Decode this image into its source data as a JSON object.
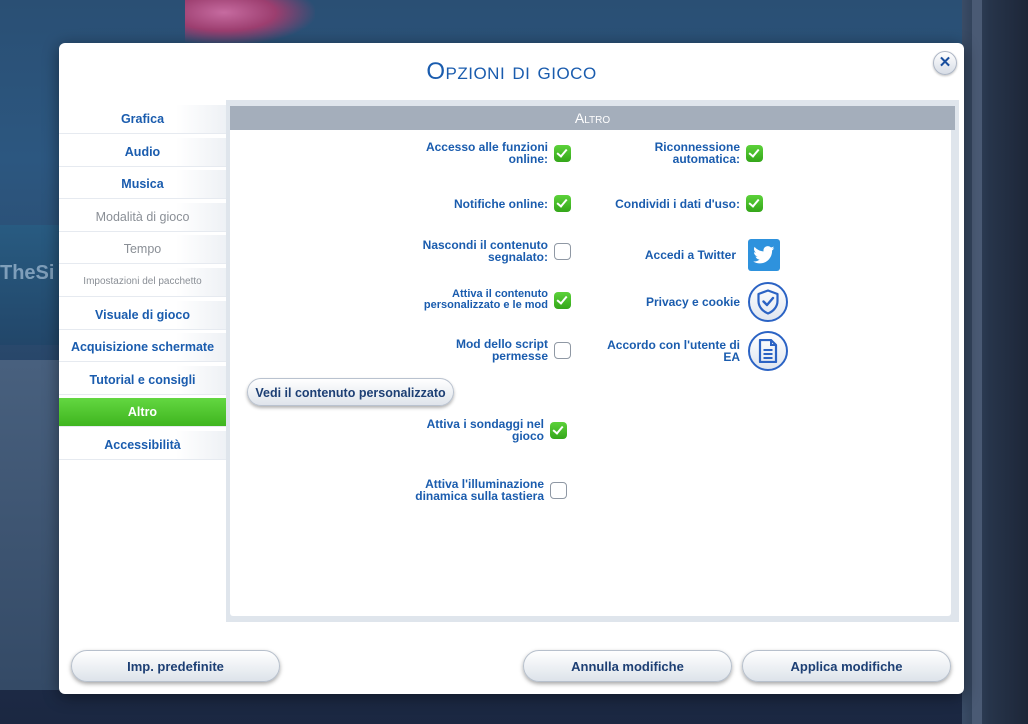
{
  "background": {
    "brand_text": "TheSi"
  },
  "dialog": {
    "title": "Opzioni di gioco",
    "close_glyph": "✕"
  },
  "sidebar": {
    "items": [
      {
        "label": "Grafica",
        "state": "enabled"
      },
      {
        "label": "Audio",
        "state": "enabled"
      },
      {
        "label": "Musica",
        "state": "enabled"
      },
      {
        "label": "Modalità di gioco",
        "state": "disabled"
      },
      {
        "label": "Tempo",
        "state": "disabled"
      },
      {
        "label": "Impostazioni del pacchetto",
        "state": "disabled"
      },
      {
        "label": "Visuale di gioco",
        "state": "enabled"
      },
      {
        "label": "Acquisizione schermate",
        "state": "enabled"
      },
      {
        "label": "Tutorial e consigli",
        "state": "enabled"
      },
      {
        "label": "Altro",
        "state": "active"
      },
      {
        "label": "Accessibilità",
        "state": "enabled"
      }
    ]
  },
  "section": {
    "title": "Altro"
  },
  "left_options": [
    {
      "label": "Accesso alle funzioni online:",
      "checked": true
    },
    {
      "label": "Notifiche online:",
      "checked": true
    },
    {
      "label": "Nascondi il contenuto segnalato:",
      "checked": false
    },
    {
      "label": "Attiva il contenuto personalizzato e le mod",
      "checked": true
    },
    {
      "label": "Mod dello script permesse",
      "checked": false
    },
    {
      "label": "Attiva i sondaggi nel gioco",
      "checked": true
    },
    {
      "label": "Attiva l'illuminazione dinamica sulla tastiera",
      "checked": false
    }
  ],
  "view_custom_content_button": "Vedi il contenuto personalizzato",
  "right_options": [
    {
      "label": "Riconnessione automatica:",
      "checked": true
    },
    {
      "label": "Condividi i dati d'uso:",
      "checked": true
    }
  ],
  "links": {
    "twitter": "Accedi a Twitter",
    "privacy": "Privacy e cookie",
    "agreement": "Accordo con l'utente di EA"
  },
  "footer": {
    "defaults": "Imp. predefinite",
    "cancel": "Annulla modifiche",
    "apply": "Applica modifiche"
  },
  "colors": {
    "accent_blue": "#1a5cae",
    "active_green": "#4cc22b",
    "twitter_blue": "#2e92dd"
  },
  "icons": [
    "close-icon",
    "checkmark-icon",
    "twitter-icon",
    "shield-check-icon",
    "document-icon"
  ]
}
